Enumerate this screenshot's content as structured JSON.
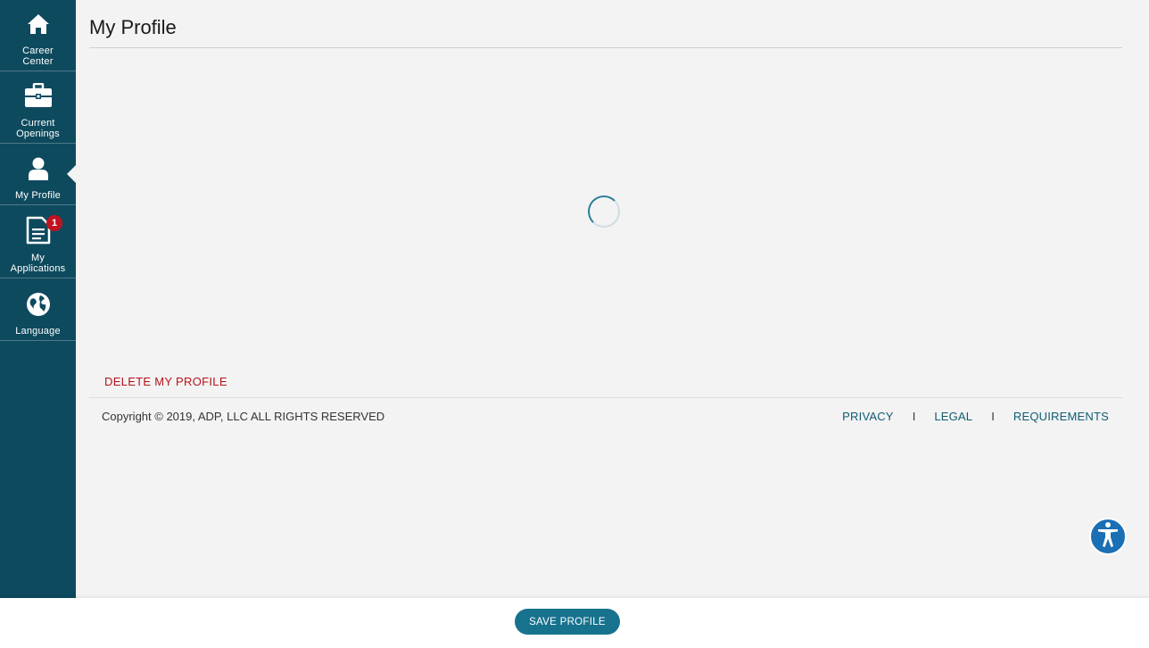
{
  "page": {
    "title": "My Profile"
  },
  "sidebar": {
    "items": [
      {
        "label": "Career Center",
        "icon": "home-icon",
        "active": false
      },
      {
        "label": "Current Openings",
        "icon": "briefcase-icon",
        "active": false
      },
      {
        "label": "My Profile",
        "icon": "user-icon",
        "active": true
      },
      {
        "label": "My Applications",
        "icon": "document-icon",
        "active": false,
        "badge": "1"
      },
      {
        "label": "Language",
        "icon": "globe-icon",
        "active": false
      }
    ]
  },
  "main": {
    "delete_label": "DELETE MY PROFILE",
    "loading": true
  },
  "footer": {
    "copyright": "Copyright © 2019, ADP, LLC ALL RIGHTS RESERVED",
    "links": [
      "PRIVACY",
      "LEGAL",
      "REQUIREMENTS"
    ],
    "separator": "I"
  },
  "actions": {
    "save_label": "SAVE PROFILE"
  },
  "colors": {
    "sidebar_bg": "#0e4a5e",
    "accent": "#17728e",
    "danger": "#b5121b",
    "badge": "#c1121f",
    "a11y": "#1b6fb5"
  }
}
